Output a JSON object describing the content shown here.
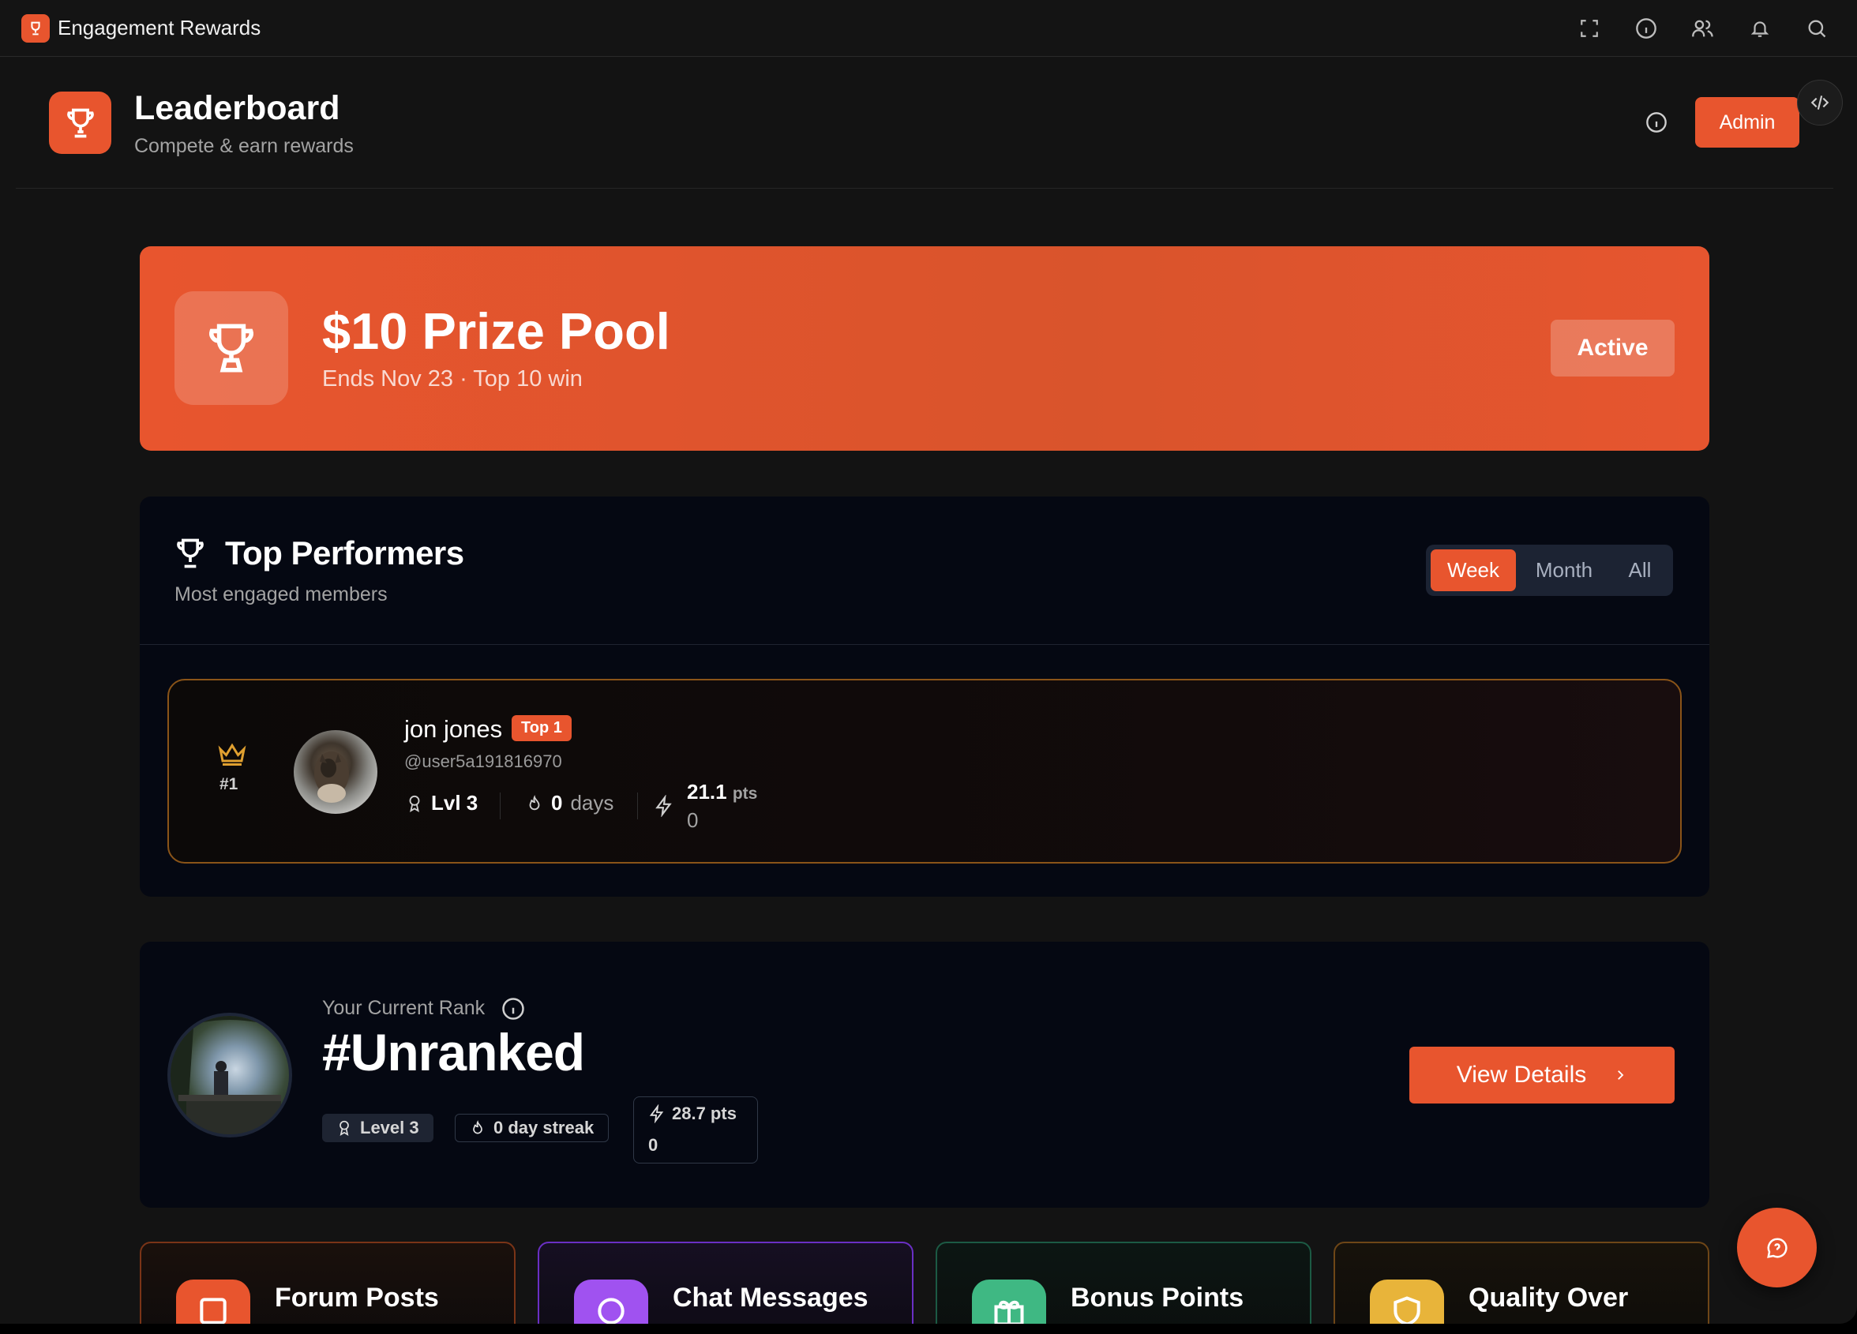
{
  "app": {
    "title": "Engagement Rewards",
    "accent_color": "#e8552e",
    "toolbar_icons": [
      "fullscreen-icon",
      "info-icon",
      "users-icon",
      "bell-icon",
      "search-icon"
    ]
  },
  "header": {
    "title": "Leaderboard",
    "subtitle": "Compete & earn rewards",
    "admin_label": "Admin"
  },
  "prize": {
    "title": "$10 Prize Pool",
    "subtitle": "Ends Nov 23 · Top 10 win",
    "status_label": "Active"
  },
  "performers": {
    "title": "Top Performers",
    "subtitle": "Most engaged members",
    "tabs": [
      "Week",
      "Month",
      "All"
    ],
    "selected_tab": "Week",
    "entries": [
      {
        "rank": "#1",
        "name": "jon jones",
        "badge": "Top 1",
        "handle": "@user5a191816970",
        "level": "Lvl 3",
        "streak_value": "0",
        "streak_unit": "days",
        "points": "21.1",
        "points_unit": "pts",
        "points_extra": "0"
      }
    ]
  },
  "current_rank": {
    "label": "Your Current Rank",
    "value": "#Unranked",
    "level": "Level 3",
    "streak": "0 day streak",
    "points": "28.7 pts",
    "points_extra": "0",
    "button_label": "View Details"
  },
  "categories": [
    {
      "title": "Forum Posts",
      "color": "#e8552e",
      "icon": "square-icon"
    },
    {
      "title": "Chat Messages",
      "color": "#a052f0",
      "icon": "chat-bubble-icon"
    },
    {
      "title": "Bonus Points",
      "color": "#3fb883",
      "icon": "gift-icon"
    },
    {
      "title": "Quality Over",
      "color": "#e8b43a",
      "icon": "shield-icon"
    }
  ]
}
